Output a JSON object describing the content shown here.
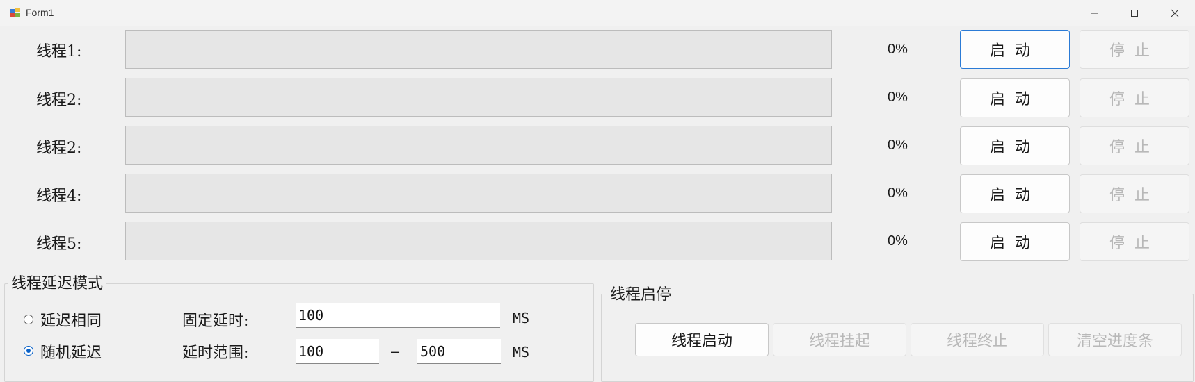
{
  "window": {
    "title": "Form1",
    "app_icon": "winforms-app-icon",
    "controls": [
      "minimize-icon",
      "maximize-icon",
      "close-icon"
    ]
  },
  "threads": [
    {
      "label": "线程1:",
      "percent": "0%",
      "progress": 0,
      "start_label": "启动",
      "stop_label": "停止",
      "start_focused": true,
      "stop_enabled": false
    },
    {
      "label": "线程2:",
      "percent": "0%",
      "progress": 0,
      "start_label": "启动",
      "stop_label": "停止",
      "start_focused": false,
      "stop_enabled": false
    },
    {
      "label": "线程2:",
      "percent": "0%",
      "progress": 0,
      "start_label": "启动",
      "stop_label": "停止",
      "start_focused": false,
      "stop_enabled": false
    },
    {
      "label": "线程4:",
      "percent": "0%",
      "progress": 0,
      "start_label": "启动",
      "stop_label": "停止",
      "start_focused": false,
      "stop_enabled": false
    },
    {
      "label": "线程5:",
      "percent": "0%",
      "progress": 0,
      "start_label": "启动",
      "stop_label": "停止",
      "start_focused": false,
      "stop_enabled": false
    }
  ],
  "delay_mode": {
    "title": "线程延迟模式",
    "options": [
      {
        "label": "延迟相同",
        "checked": false
      },
      {
        "label": "随机延迟",
        "checked": true
      }
    ],
    "fixed_delay_label": "固定延时:",
    "fixed_delay_value": "100",
    "range_label": "延时范围:",
    "range_min": "100",
    "range_separator": "–",
    "range_max": "500",
    "unit": "MS"
  },
  "thread_control": {
    "title": "线程启停",
    "buttons": [
      {
        "label": "线程启动",
        "enabled": true
      },
      {
        "label": "线程挂起",
        "enabled": false
      },
      {
        "label": "线程终止",
        "enabled": false
      },
      {
        "label": "清空进度条",
        "enabled": false
      }
    ]
  },
  "colors": {
    "window_bg": "#f0f0f0",
    "focus_border": "#2b7bd6",
    "radio_accent": "#0a62c8",
    "disabled_text": "#b8b8b8",
    "progress_fill": "#06b025"
  }
}
